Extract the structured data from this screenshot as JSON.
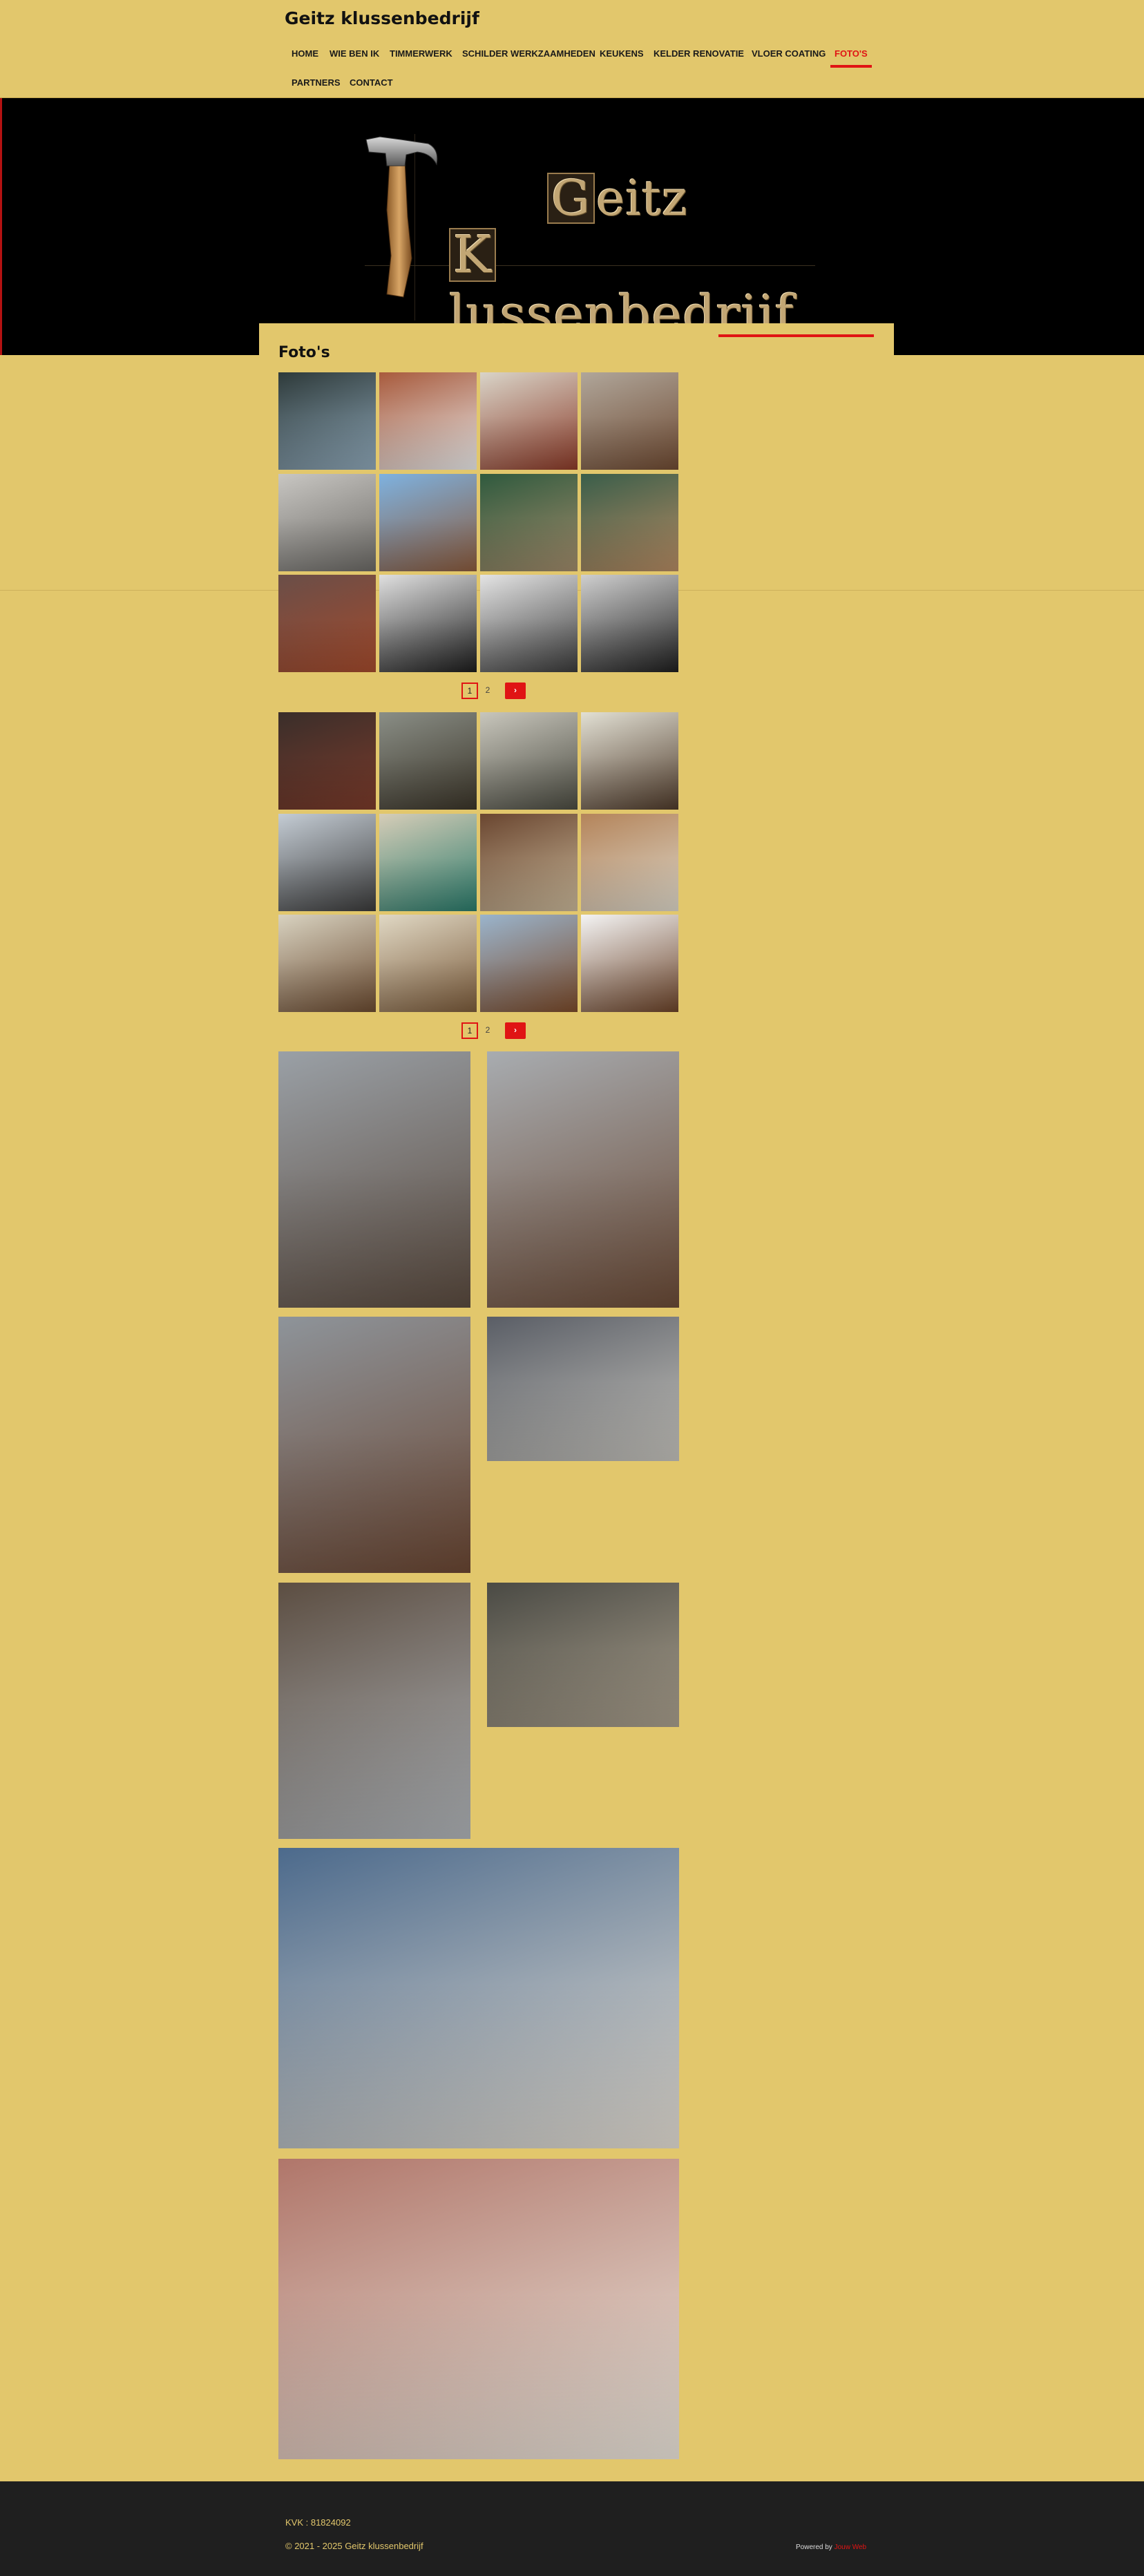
{
  "site": {
    "title": "Geitz klussenbedrijf"
  },
  "nav": {
    "items": [
      "HOME",
      "WIE BEN IK",
      "TIMMERWERK",
      "SCHILDER WERKZAAMHEDEN",
      "KEUKENS",
      "KELDER RENOVATIE",
      "VLOER COATING",
      "FOTO'S",
      "PARTNERS",
      "CONTACT"
    ],
    "active": "FOTO'S",
    "accent_color": "#e01414"
  },
  "banner": {
    "logo_line1_cap": "G",
    "logo_line1_rest": "eitz",
    "logo_line2_cap": "K",
    "logo_line2_rest": "lussenbedrijf",
    "background": "#000000",
    "icon": "hammer-icon"
  },
  "page": {
    "heading": "Foto's",
    "background": "#e2c76c"
  },
  "gallery1": {
    "pager": {
      "current": "1",
      "other": "2",
      "next": "›"
    }
  },
  "gallery2": {
    "pager": {
      "current": "1",
      "other": "2",
      "next": "›"
    }
  },
  "footer": {
    "kvk": "KVK : 81824092",
    "copyright": "© 2021 - 2025 Geitz klussenbedrijf",
    "powered_prefix": "Powered by ",
    "powered_link": "Jouw Web",
    "background": "#1f1f1f"
  }
}
